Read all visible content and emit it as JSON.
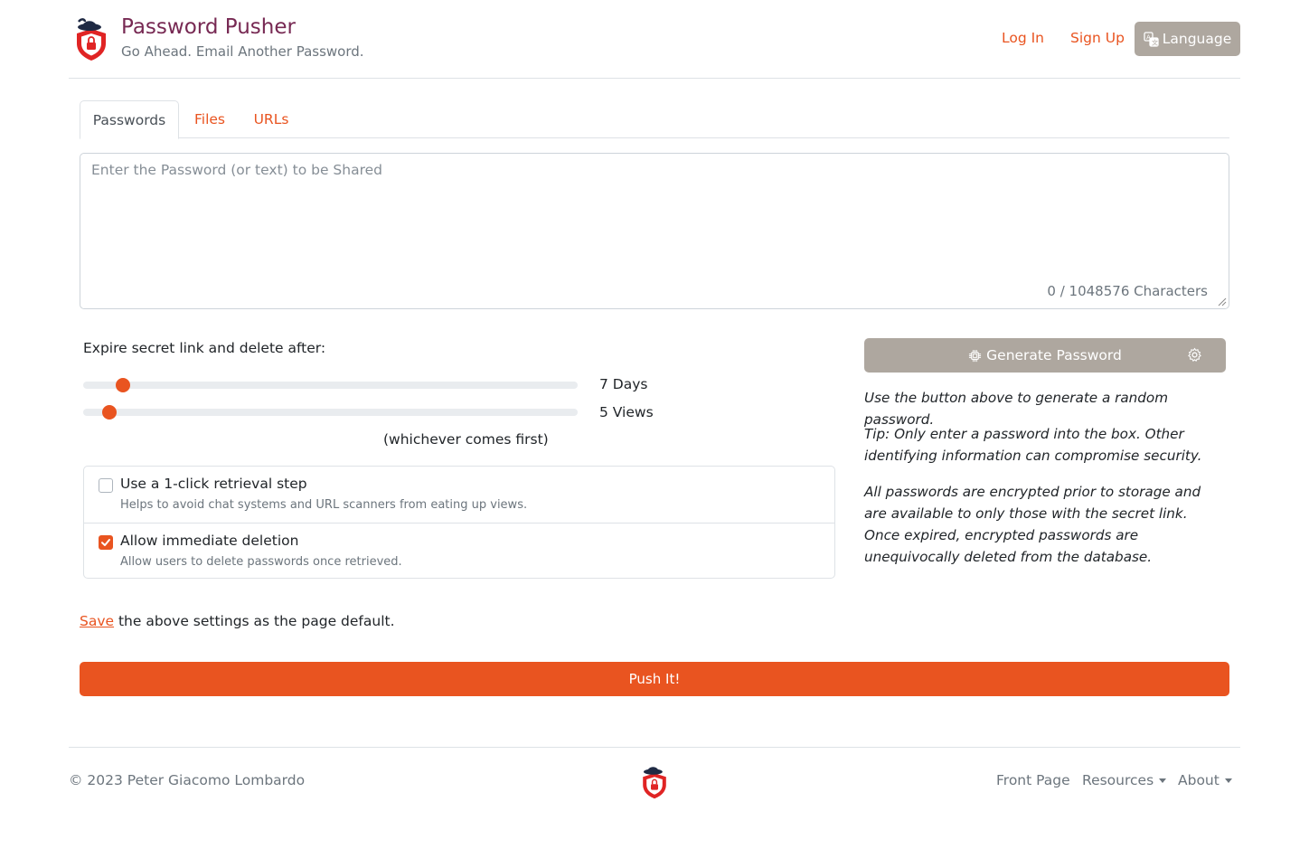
{
  "header": {
    "title": "Password Pusher",
    "subtitle": "Go Ahead. Email Another Password.",
    "login": "Log In",
    "signup": "Sign Up",
    "language": "Language"
  },
  "tabs": [
    {
      "label": "Passwords",
      "active": true
    },
    {
      "label": "Files",
      "active": false
    },
    {
      "label": "URLs",
      "active": false
    }
  ],
  "payload": {
    "placeholder": "Enter the Password (or text) to be Shared",
    "counter": "0 / 1048576 Characters"
  },
  "expire": {
    "label": "Expire secret link and delete after:",
    "days_label": "7 Days",
    "days_value": 7,
    "days_max": 90,
    "views_label": "5 Views",
    "views_value": 5,
    "views_max": 100,
    "whichever": "(whichever comes first)"
  },
  "options": [
    {
      "title": "Use a 1-click retrieval step",
      "help": "Helps to avoid chat systems and URL scanners from eating up views.",
      "checked": false
    },
    {
      "title": "Allow immediate deletion",
      "help": "Allow users to delete passwords once retrieved.",
      "checked": true
    }
  ],
  "generator": {
    "button": "Generate Password",
    "info1": "Use the button above to generate a random password.",
    "info2": "Tip: Only enter a password into the box. Other identifying information can compromise security.",
    "info3": "All passwords are encrypted prior to storage and are available to only those with the secret link. Once expired, encrypted passwords are unequivocally deleted from the database."
  },
  "save": {
    "link": "Save",
    "text": " the above settings as the page default."
  },
  "push_button": "Push It!",
  "footer": {
    "copyright": "© 2023 Peter Giacomo Lombardo",
    "front_page": "Front Page",
    "resources": "Resources",
    "about": "About"
  },
  "colors": {
    "accent": "#e95420",
    "brand": "#772953",
    "muted_button": "#aea79f"
  }
}
